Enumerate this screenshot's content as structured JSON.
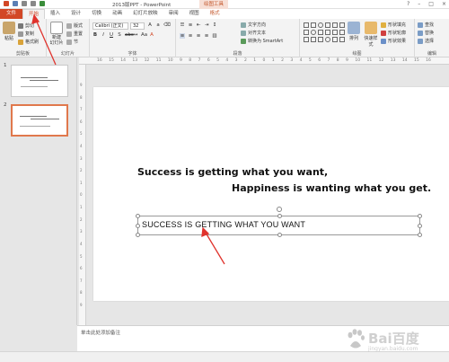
{
  "window": {
    "title": "2013版PPT - PowerPoint",
    "context_tab": "绘图工具",
    "controls": [
      "?",
      "–",
      "□",
      "×"
    ]
  },
  "tabs": [
    "文件",
    "开始",
    "插入",
    "设计",
    "切换",
    "动画",
    "幻灯片放映",
    "审阅",
    "视图",
    "格式"
  ],
  "ribbon": {
    "clipboard": {
      "paste": "粘贴",
      "cut": "剪切",
      "copy": "复制",
      "format_painter": "格式刷",
      "label": "剪贴板"
    },
    "slides": {
      "new_slide": "新建\n幻灯片",
      "layout": "版式",
      "reset": "重置",
      "section": "节",
      "label": "幻灯片"
    },
    "font": {
      "name": "Calibri (正文)",
      "size": "32",
      "label": "字体"
    },
    "paragraph": {
      "text_direction": "文字方向",
      "align_text": "对齐文本",
      "smartart": "转换为 SmartArt",
      "label": "段落"
    },
    "drawing": {
      "arrange": "排列",
      "quick_styles": "快速样式",
      "fill": "形状填充",
      "outline": "形状轮廓",
      "effects": "形状效果",
      "label": "绘图"
    },
    "editing": {
      "find": "查找",
      "replace": "替换",
      "select": "选择",
      "label": "编辑"
    }
  },
  "thumbnails": [
    {
      "number": "1"
    },
    {
      "number": "2"
    }
  ],
  "ruler": {
    "h_ticks": [
      "16",
      "15",
      "14",
      "13",
      "12",
      "11",
      "10",
      "9",
      "8",
      "7",
      "6",
      "5",
      "4",
      "3",
      "2",
      "1",
      "0",
      "1",
      "2",
      "3",
      "4",
      "5",
      "6",
      "7",
      "8",
      "9",
      "10",
      "11",
      "12",
      "13",
      "14",
      "15",
      "16"
    ],
    "v_ticks": [
      "9",
      "8",
      "7",
      "6",
      "5",
      "4",
      "3",
      "2",
      "1",
      "0",
      "1",
      "2",
      "3",
      "4",
      "5",
      "6",
      "7",
      "8",
      "9"
    ]
  },
  "slide": {
    "line1": "Success is getting what you want,",
    "line2": "Happiness is wanting what you get.",
    "textbox": "SUCCESS IS GETTING WHAT YOU WANT"
  },
  "notes": {
    "placeholder": "单击此处添加备注"
  },
  "watermark": {
    "text": "Bai百度",
    "url": "jingyan.baidu.com"
  },
  "colors": {
    "accent": "#d24726",
    "arrow": "#e0332d",
    "selection": "#e0784c"
  }
}
